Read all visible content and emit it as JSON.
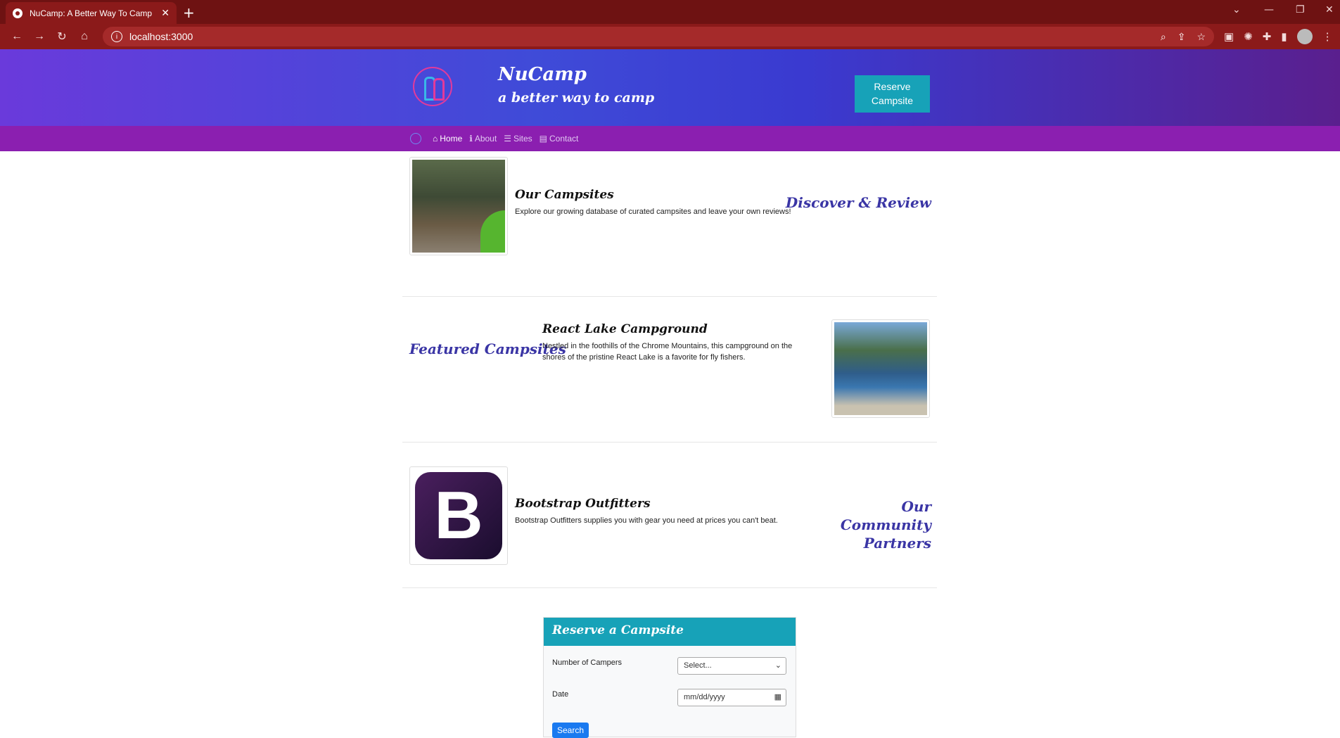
{
  "browser": {
    "tab_title": "NuCamp: A Better Way To Camp",
    "tab_close": "✕",
    "new_tab": "+",
    "url": "localhost:3000",
    "win_chevron": "⌄",
    "win_min": "—",
    "win_restore": "❐",
    "win_close": "✕"
  },
  "header": {
    "brand": "NuCamp",
    "tagline": "a better way to camp",
    "reserve_button": "Reserve Campsite"
  },
  "nav": {
    "items": [
      {
        "label": "Home",
        "icon": "home-icon",
        "active": true
      },
      {
        "label": "About",
        "icon": "info-icon",
        "active": false
      },
      {
        "label": "Sites",
        "icon": "list-icon",
        "active": false
      },
      {
        "label": "Contact",
        "icon": "address-card-icon",
        "active": false
      }
    ]
  },
  "rows": [
    {
      "title": "Our Campsites",
      "text": "Explore our growing database of curated campsites and leave your own reviews!",
      "feature": "Discover & Review"
    },
    {
      "title": "React Lake Campground",
      "text": "Nestled in the foothills of the Chrome Mountains, this campground on the shores of the pristine React Lake is a favorite for fly fishers.",
      "feature": "Featured Campsites"
    },
    {
      "title": "Bootstrap Outfitters",
      "text": "Bootstrap Outfitters supplies you with gear you need at prices you can't beat.",
      "feature": "Our Community Partners"
    }
  ],
  "reserve_form": {
    "title": "Reserve a Campsite",
    "campers_label": "Number of Campers",
    "campers_value": "Select...",
    "date_label": "Date",
    "date_placeholder": "mm/dd/yyyy",
    "search_button": "Search"
  },
  "colors": {
    "browser_frame": "#8b1a1a",
    "nav_bg": "#8b1fb0",
    "accent": "#17a2b8",
    "feature_text": "#3a35a5"
  }
}
